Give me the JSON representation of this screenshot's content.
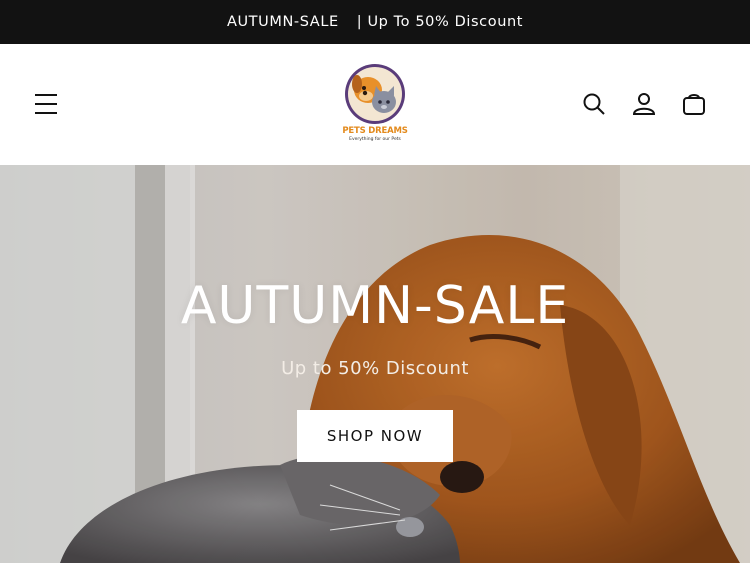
{
  "announcement": {
    "part1": "AUTUMN-SALE",
    "part2": "| Up To 50% Discount"
  },
  "header": {
    "logo": {
      "title": "PETS DREAMS",
      "tagline": "Everything for our Pets"
    },
    "icons": [
      "menu-icon",
      "search-icon",
      "account-icon",
      "cart-icon"
    ]
  },
  "hero": {
    "title": "AUTUMN-SALE",
    "subtitle": "Up to 50% Discount",
    "button_label": "SHOP NOW"
  },
  "colors": {
    "announcement_bg": "#121212",
    "logo_orange": "#e38a1c",
    "logo_purple": "#5a3c7a",
    "text_dark": "#121212"
  }
}
